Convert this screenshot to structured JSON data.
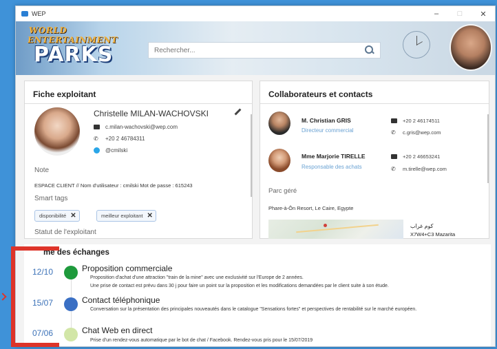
{
  "window": {
    "title": "WEP",
    "ctrl_min": "–",
    "ctrl_max": "□",
    "ctrl_close": "✕"
  },
  "header": {
    "logo_line1": "WORLD ENTERTAINMENT",
    "logo_line2": "PARKS",
    "search_placeholder": "Rechercher..."
  },
  "exploitant": {
    "title": "Fiche exploitant",
    "name": "Christelle MILAN-WACHOVSKI",
    "email": "c.milan-wachovski@wep.com",
    "phone": "+20 2 46784311",
    "skype": "@cmilski",
    "note_label": "Note",
    "note_text": "ESPACE CLIENT // Nom d'utilisateur : cmilski Mot de passe : 615243",
    "tags_label": "Smart tags",
    "tags": [
      "disponibilité",
      "meilleur exploitant"
    ],
    "status_label": "Statut de l'exploitant"
  },
  "contacts": {
    "title": "Collaborateurs et contacts",
    "items": [
      {
        "name": "M. Christian GRIS",
        "role": "Directeur commercial",
        "phone": "+20 2 46174511",
        "email": "c.gris@wep.com"
      },
      {
        "name": "Mme Marjorie TIRELLE",
        "role": "Responsable des achats",
        "phone": "+20 2 46653241",
        "email": "m.tirelle@wep.com"
      }
    ],
    "park_label": "Parc géré",
    "park_text": "Phare-à-Ôn Resort, Le Caire, Egypte",
    "addr_line1": "كوم غراب",
    "addr_line2": "X7W4+C3 Mazarita"
  },
  "exchanges": {
    "title": "mé des échanges",
    "items": [
      {
        "date": "12/10",
        "title": "Proposition commerciale",
        "color": "#1e9a3c",
        "desc1": "Proposition d'achat d'une attraction \"train de la mine\" avec une exclusivité sur l'Europe de 2 années.",
        "desc2": "Une prise de contact est prévu dans 30 j pour faire un point sur la proposition et les modifications demandées par le client suite à son étude."
      },
      {
        "date": "15/07",
        "title": "Contact téléphonique",
        "color": "#3a6fc4",
        "desc1": "Conversation sur la présentation des principales nouveautés dans le catalogue \"Sensations fortes\"  et perspectives de rentabilité sur le marché européen.",
        "desc2": ""
      },
      {
        "date": "07/06",
        "title": "Chat Web en direct",
        "color": "#d2e6a7",
        "desc1": "Prise d'un rendez-vous automatique par le bot de chat / Facebook. Rendez-vous pris pour le 15/07/2019",
        "desc2": ""
      }
    ]
  },
  "colors": {
    "accent": "#de3429",
    "link": "#6aa2d3",
    "date": "#3c72b8"
  }
}
